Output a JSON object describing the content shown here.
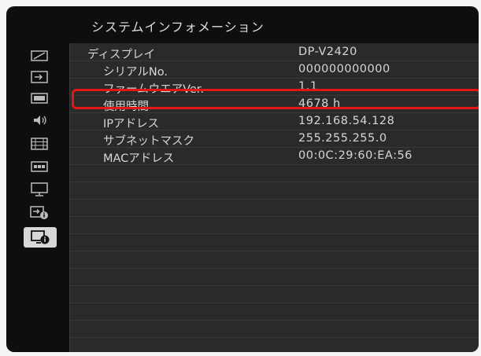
{
  "title": "システムインフォメーション",
  "sidebar": {
    "items": [
      {
        "icon": "picture-adjust-icon"
      },
      {
        "icon": "input-icon"
      },
      {
        "icon": "screen-icon"
      },
      {
        "icon": "audio-icon"
      },
      {
        "icon": "display-settings-icon"
      },
      {
        "icon": "timer-icon"
      },
      {
        "icon": "monitor-icon"
      },
      {
        "icon": "input-info-icon"
      },
      {
        "icon": "system-info-icon",
        "active": true
      }
    ]
  },
  "info": {
    "rows": [
      {
        "label": "ディスプレイ",
        "value": "DP-V2420"
      },
      {
        "label": "シリアルNo.",
        "value": "000000000000"
      },
      {
        "label": "ファームウエアVer.",
        "value": "1.1"
      },
      {
        "label": "使用時間",
        "value": "4678 h"
      },
      {
        "label": "IPアドレス",
        "value": "192.168.54.128"
      },
      {
        "label": "サブネットマスク",
        "value": "255.255.255.0"
      },
      {
        "label": "MACアドレス",
        "value": "00:0C:29:60:EA:56"
      }
    ]
  },
  "colors": {
    "highlight": "#e01818",
    "panel": "#2a2a2a",
    "background": "#0e0e0e"
  }
}
